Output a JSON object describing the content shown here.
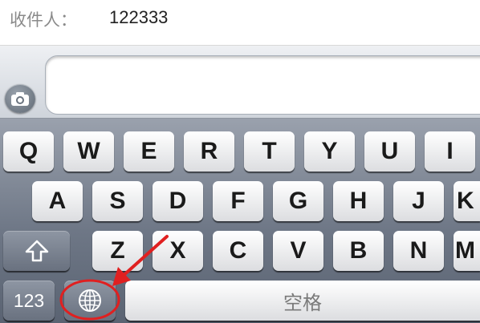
{
  "header": {
    "to_label": "收件人：",
    "to_value": "122333"
  },
  "compose": {
    "camera_icon": "camera-icon",
    "message_value": ""
  },
  "keyboard": {
    "row1": [
      "Q",
      "W",
      "E",
      "R",
      "T",
      "Y",
      "U",
      "I"
    ],
    "row2": [
      "A",
      "S",
      "D",
      "F",
      "G",
      "H",
      "J",
      "K"
    ],
    "row3": [
      "Z",
      "X",
      "C",
      "V",
      "B",
      "N",
      "M"
    ],
    "shift_icon": "shift-arrow-icon",
    "numbers_label": "123",
    "globe_icon": "globe-icon",
    "space_label": "空格"
  },
  "annotation": {
    "color": "#e02020"
  }
}
